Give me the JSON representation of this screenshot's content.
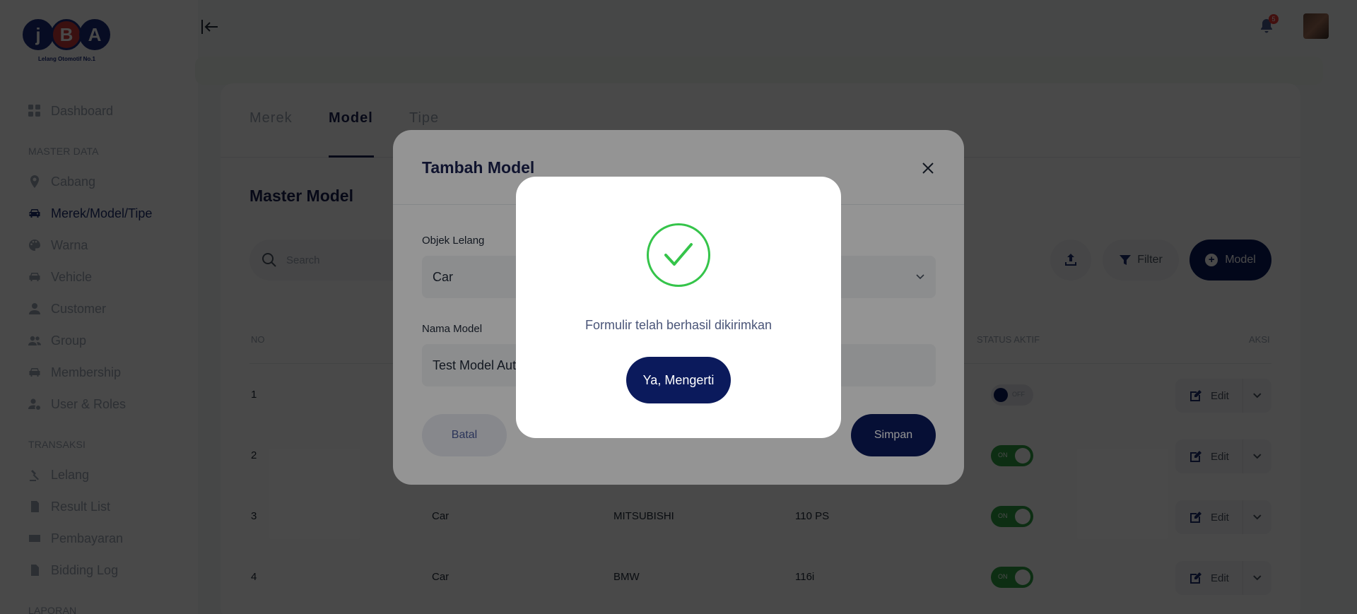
{
  "logo": {
    "letters": [
      "j",
      "B",
      "A"
    ],
    "tagline": "Lelang Otomotif No.1"
  },
  "sidebar": {
    "items": [
      {
        "label": "Dashboard",
        "icon": "grid-icon"
      },
      {
        "section": "MASTER DATA"
      },
      {
        "label": "Cabang",
        "icon": "location-pin-icon"
      },
      {
        "label": "Merek/Model/Tipe",
        "icon": "car-icon",
        "active": true
      },
      {
        "label": "Warna",
        "icon": "palette-icon"
      },
      {
        "label": "Vehicle",
        "icon": "car-icon"
      },
      {
        "label": "Customer",
        "icon": "user-icon"
      },
      {
        "label": "Group",
        "icon": "users-icon"
      },
      {
        "label": "Membership",
        "icon": "car-icon"
      },
      {
        "label": "User & Roles",
        "icon": "user-gear-icon"
      },
      {
        "section": "TRANSAKSI"
      },
      {
        "label": "Lelang",
        "icon": "gavel-icon"
      },
      {
        "label": "Result List",
        "icon": "document-icon"
      },
      {
        "label": "Pembayaran",
        "icon": "card-icon"
      },
      {
        "label": "Bidding Log",
        "icon": "file-icon"
      },
      {
        "section": "LAPORAN"
      }
    ]
  },
  "header": {
    "notification_count": "5"
  },
  "tabs": [
    {
      "label": "Merek"
    },
    {
      "label": "Model",
      "active": true
    },
    {
      "label": "Tipe"
    }
  ],
  "page_title": "Master Model",
  "search": {
    "placeholder": "Search"
  },
  "toolbar": {
    "filter_label": "Filter",
    "add_label": "Model"
  },
  "table": {
    "headers": {
      "no": "NO",
      "status": "STATUS AKTIF",
      "action": "AKSI"
    },
    "rows": [
      {
        "no": "1",
        "objek": "",
        "merek": "",
        "model": "",
        "status": "OFF"
      },
      {
        "no": "2",
        "objek": "",
        "merek": "",
        "model": "",
        "status": "ON"
      },
      {
        "no": "3",
        "objek": "Car",
        "merek": "MITSUBISHI",
        "model": "110 PS",
        "status": "ON"
      },
      {
        "no": "4",
        "objek": "Car",
        "merek": "BMW",
        "model": "116i",
        "status": "ON"
      }
    ],
    "edit_label": "Edit"
  },
  "modal": {
    "title": "Tambah Model",
    "objek_label": "Objek Lelang",
    "objek_value": "Car",
    "nama_label": "Nama Model",
    "nama_value": "Test Model Auto",
    "cancel_label": "Batal",
    "save_label": "Simpan"
  },
  "alert": {
    "message": "Formulir telah berhasil dikirimkan",
    "confirm_label": "Ya, Mengerti",
    "icon": "check-icon",
    "color": "#35c44a"
  },
  "colors": {
    "primary": "#0b1a5c",
    "success": "#2ea043",
    "danger": "#e53935"
  }
}
